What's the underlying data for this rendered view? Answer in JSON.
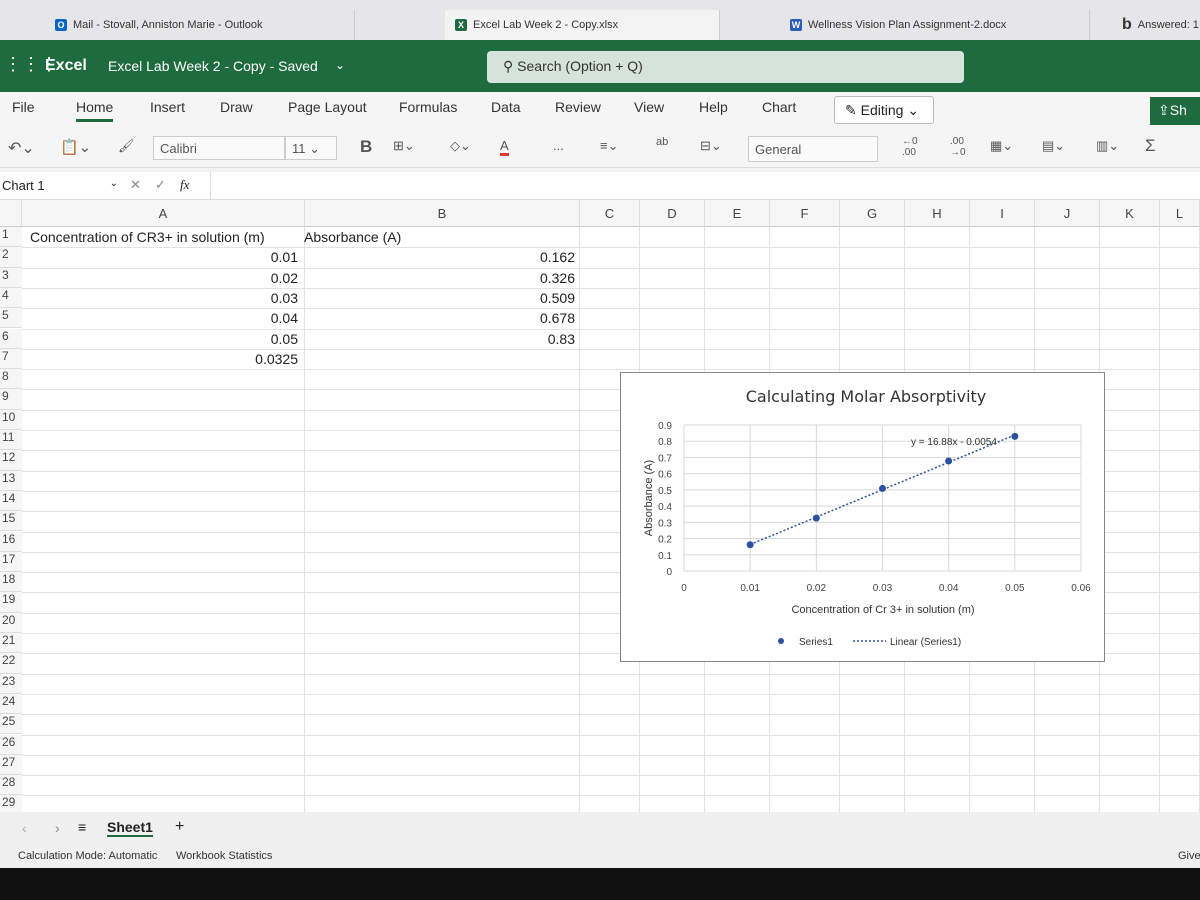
{
  "browser_tabs": [
    {
      "label": "Mail - Stovall, Anniston Marie - Outlook",
      "icon": "outlook-icon",
      "color": "#0a64c8"
    },
    {
      "label": "Excel Lab Week 2 - Copy.xlsx",
      "icon": "excel-icon",
      "color": "#1e6b3f"
    },
    {
      "label": "Wellness Vision Plan Assignment-2.docx",
      "icon": "word-icon",
      "color": "#2b5cb8"
    },
    {
      "label": "Answered: 1",
      "icon": "bing-icon",
      "color": "#222"
    }
  ],
  "header": {
    "app": "Excel",
    "doc_title": "Excel Lab Week 2 - Copy - Saved",
    "search_placeholder": "Search (Option + Q)"
  },
  "ribbon": {
    "tabs": [
      "File",
      "Home",
      "Insert",
      "Draw",
      "Page Layout",
      "Formulas",
      "Data",
      "Review",
      "View",
      "Help",
      "Chart"
    ],
    "active": "Home",
    "editing": "Editing",
    "share": "Sh"
  },
  "toolbar": {
    "font": "Calibri",
    "size": "11",
    "bold": "B",
    "number_format": "General",
    "more": "...",
    "sum": "Σ"
  },
  "formula_bar": {
    "name_box": "Chart 1",
    "fx": "fx"
  },
  "columns": [
    "A",
    "B",
    "C",
    "D",
    "E",
    "F",
    "G",
    "H",
    "I",
    "J",
    "K",
    "L"
  ],
  "rows": [
    "1",
    "2",
    "3",
    "4",
    "5",
    "6",
    "7",
    "8",
    "9",
    "10",
    "11",
    "12",
    "13",
    "14",
    "15",
    "16",
    "17",
    "18",
    "19",
    "20",
    "21",
    "22",
    "23",
    "24",
    "25",
    "26",
    "27",
    "28",
    "29"
  ],
  "cells": {
    "A1": "Concentration of CR3+ in solution (m)",
    "B1": "Absorbance (A)",
    "A": [
      "0.01",
      "0.02",
      "0.03",
      "0.04",
      "0.05",
      "0.0325"
    ],
    "B": [
      "0.162",
      "0.326",
      "0.509",
      "0.678",
      "0.83"
    ]
  },
  "chart_data": {
    "type": "scatter",
    "title": "Calculating Molar Absorptivity",
    "xlabel": "Concentration of Cr 3+ in solution (m)",
    "ylabel": "Absorbance (A)",
    "xlim": [
      0,
      0.06
    ],
    "ylim": [
      0,
      0.9
    ],
    "xticks": [
      "0",
      "0.01",
      "0.02",
      "0.03",
      "0.04",
      "0.05",
      "0.06"
    ],
    "yticks": [
      "0",
      "0.1",
      "0.2",
      "0.3",
      "0.4",
      "0.5",
      "0.6",
      "0.7",
      "0.8",
      "0.9"
    ],
    "grid": true,
    "legend_position": "bottom",
    "series": [
      {
        "name": "Series1",
        "color": "#2a52a0",
        "x": [
          0.01,
          0.02,
          0.03,
          0.04,
          0.05
        ],
        "y": [
          0.162,
          0.326,
          0.509,
          0.678,
          0.83
        ]
      }
    ],
    "trendline": {
      "name": "Linear (Series1)",
      "slope": 16.88,
      "intercept": -0.0054,
      "equation": "y = 16.88x - 0.0054"
    }
  },
  "sheet": {
    "tab": "Sheet1",
    "add": "+"
  },
  "status": {
    "calc_mode": "Calculation Mode: Automatic",
    "stats": "Workbook Statistics",
    "give": "Give"
  }
}
